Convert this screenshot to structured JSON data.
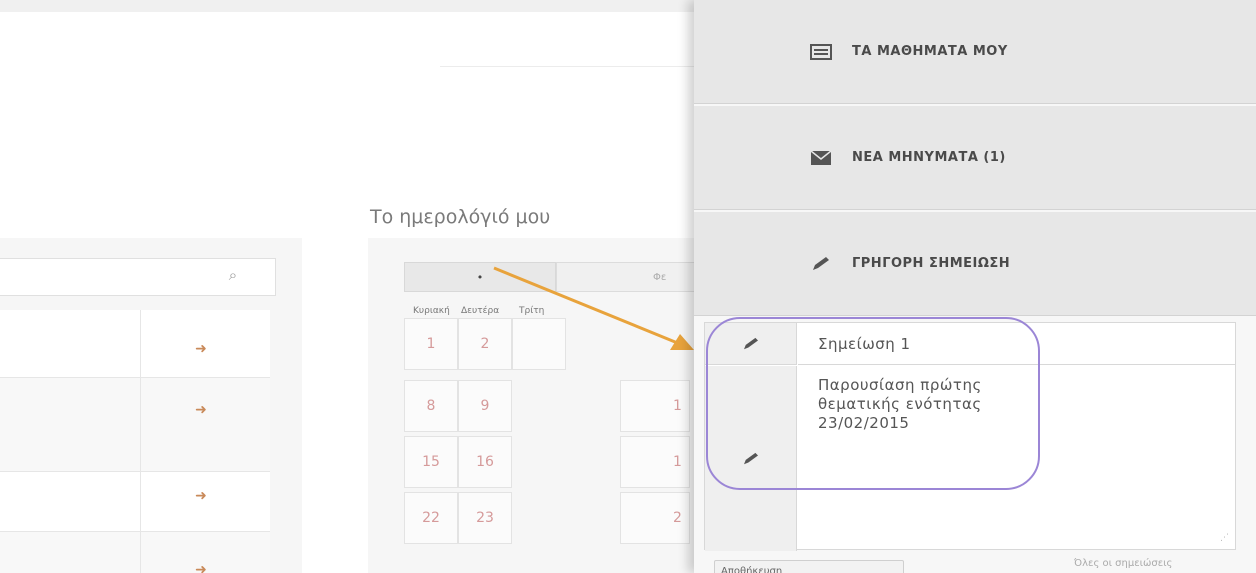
{
  "drawer": {
    "items": [
      {
        "label": "ΤΑ ΜΑΘΗΜΑΤΑ ΜΟΥ",
        "icon": "courses-icon"
      },
      {
        "label": "ΝΕΑ ΜΗΝΥΜΑΤΑ (1)",
        "icon": "envelope-icon"
      },
      {
        "label": "ΓΡΗΓΟΡΗ ΣΗΜΕΙΩΣΗ",
        "icon": "pencil-icon"
      }
    ],
    "note": {
      "title": "Σημείωση 1",
      "body": "Παρουσίαση πρώτης\nθεματικής ενότητας\n23/02/2015"
    },
    "save_label": "Αποθήκευση",
    "all_notes_label": "Όλες οι σημειώσεις"
  },
  "calendar": {
    "title": "Το ημερολόγιό μου",
    "prev_label": "•",
    "month_label": "Φε",
    "day_names": [
      "Κυριακή",
      "Δευτέρα",
      "Τρίτη"
    ],
    "rows": [
      [
        "1",
        "2",
        ""
      ],
      [
        "8",
        "9",
        "1"
      ],
      [
        "15",
        "16",
        "1"
      ],
      [
        "22",
        "23",
        "2"
      ]
    ]
  },
  "list": {
    "search_icon": "search-icon",
    "row_icon": "sign-in-icon"
  },
  "colors": {
    "highlight": "#9b86d6",
    "arrow": "#e8a33c",
    "calendar_day_text": "#d59a9a"
  }
}
